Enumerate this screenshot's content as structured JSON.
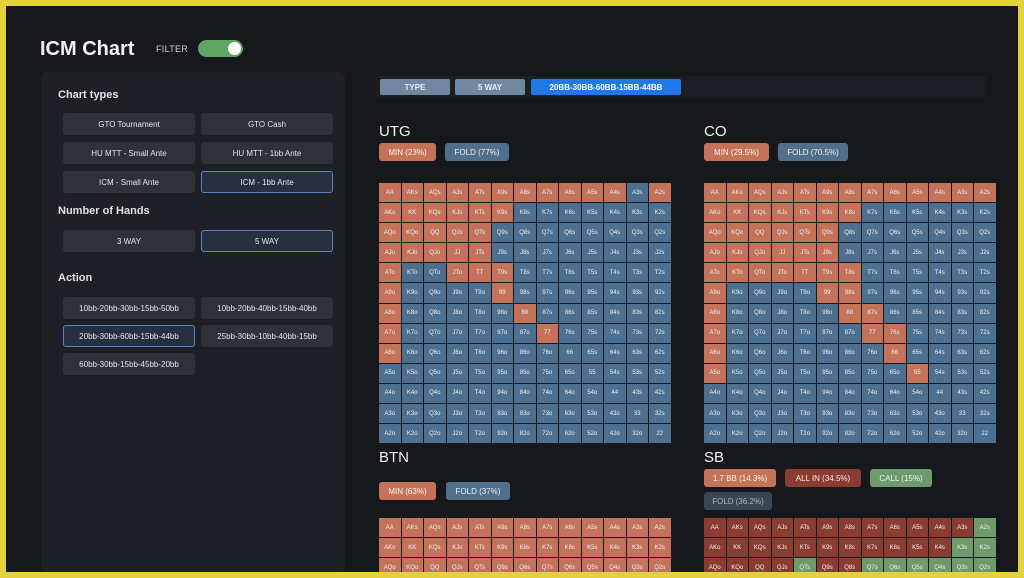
{
  "header": {
    "title": "ICM Chart",
    "filter_label": "FILTER",
    "filter_on": true
  },
  "sidebar": {
    "chart_types_heading": "Chart types",
    "chart_types": [
      {
        "label": "GTO Tournament",
        "selected": false
      },
      {
        "label": "GTO Cash",
        "selected": false
      },
      {
        "label": "HU MTT - Small Ante",
        "selected": false
      },
      {
        "label": "HU MTT - 1bb Ante",
        "selected": false
      },
      {
        "label": "ICM - Small Ante",
        "selected": false
      },
      {
        "label": "ICM - 1bb Ante",
        "selected": true
      }
    ],
    "hands_heading": "Number of Hands",
    "hands": [
      {
        "label": "3 WAY",
        "selected": false
      },
      {
        "label": "5 WAY",
        "selected": true
      }
    ],
    "action_heading": "Action",
    "actions": [
      {
        "label": "10bb-20bb-30bb-15bb-50bb",
        "selected": false
      },
      {
        "label": "10bb-20bb-40bb-15bb-40bb",
        "selected": false
      },
      {
        "label": "20bb-30bb-60bb-15bb-44bb",
        "selected": true
      },
      {
        "label": "25bb-30bb-10bb-40bb-15bb",
        "selected": false
      },
      {
        "label": "60bb-30bb-15bb-45bb-20bb",
        "selected": false
      }
    ]
  },
  "breadcrumb": [
    "TYPE",
    "5 WAY",
    "20BB-30BB-60BB-15BB-44BB"
  ],
  "charts": {
    "utg": {
      "title": "UTG",
      "badges": [
        {
          "label": "MIN (23%)",
          "kind": "raise"
        },
        {
          "label": "FOLD (77%)",
          "kind": "fold"
        }
      ],
      "grid": [
        "RRRRRRRRRRRFR",
        "RRRRRRFFFFFFF",
        "RRRRRFFFFFFFF",
        "RRRRRFFFFFFFF",
        "RFFRRRFFFFFFF",
        "RFFFFRFFFFFFF",
        "RFFFFFRFFFFFF",
        "RFFFFFFRFFFFF",
        "RFFFFFFFFFFFF",
        "FFFFFFFFFFFFF",
        "FFFFFFFFFFFFF",
        "FFFFFFFFFFFFF",
        "FFFFFFFFFFFFF"
      ]
    },
    "co": {
      "title": "CO",
      "badges": [
        {
          "label": "MIN (29.5%)",
          "kind": "raise"
        },
        {
          "label": "FOLD (70.5%)",
          "kind": "fold"
        }
      ],
      "grid": [
        "RRRRRRRRRRRRR",
        "RRRRRRRFFFFFF",
        "RRRRRRFFFFFFF",
        "RRRRRRFFFFFFF",
        "RRRRRRRFFFFFF",
        "RFFFFRRFFFFFF",
        "RFFFFFRRFFFFF",
        "RFFFFFFRRFFFF",
        "RFFFFFFFRFFFF",
        "RFFFFFFFFRFFF",
        "FFFFFFFFFFFFF",
        "FFFFFFFFFFFFF",
        "FFFFFFFFFFFFF"
      ]
    },
    "btn": {
      "title": "BTN",
      "badges": [
        {
          "label": "MIN (63%)",
          "kind": "raise"
        },
        {
          "label": "FOLD (37%)",
          "kind": "fold"
        }
      ],
      "grid": [
        "RRRRRRRRRRRRR",
        "RRRRRRRRRRRRR",
        "RRRRRRRRRRRRR"
      ]
    },
    "sb": {
      "title": "SB",
      "badges": [
        {
          "label": "1.7 BB (14.3%)",
          "kind": "raise"
        },
        {
          "label": "ALL IN (34.5%)",
          "kind": "allin"
        },
        {
          "label": "CALL (15%)",
          "kind": "call"
        },
        {
          "label": "FOLD (36.2%)",
          "kind": "fold-dim"
        }
      ],
      "grid": [
        "AAAAAAAAAAAAC",
        "AAAAAAAAAAACC",
        "AAAACAACCCCCC"
      ]
    }
  },
  "colors": {
    "raise": "#c4735a",
    "fold": "#4d7090",
    "allin": "#8b3c31",
    "call": "#6f9a6c",
    "accent_blue": "#1f78e6",
    "toggle_green": "#5fa564",
    "frame_yellow": "#e3d23c"
  }
}
